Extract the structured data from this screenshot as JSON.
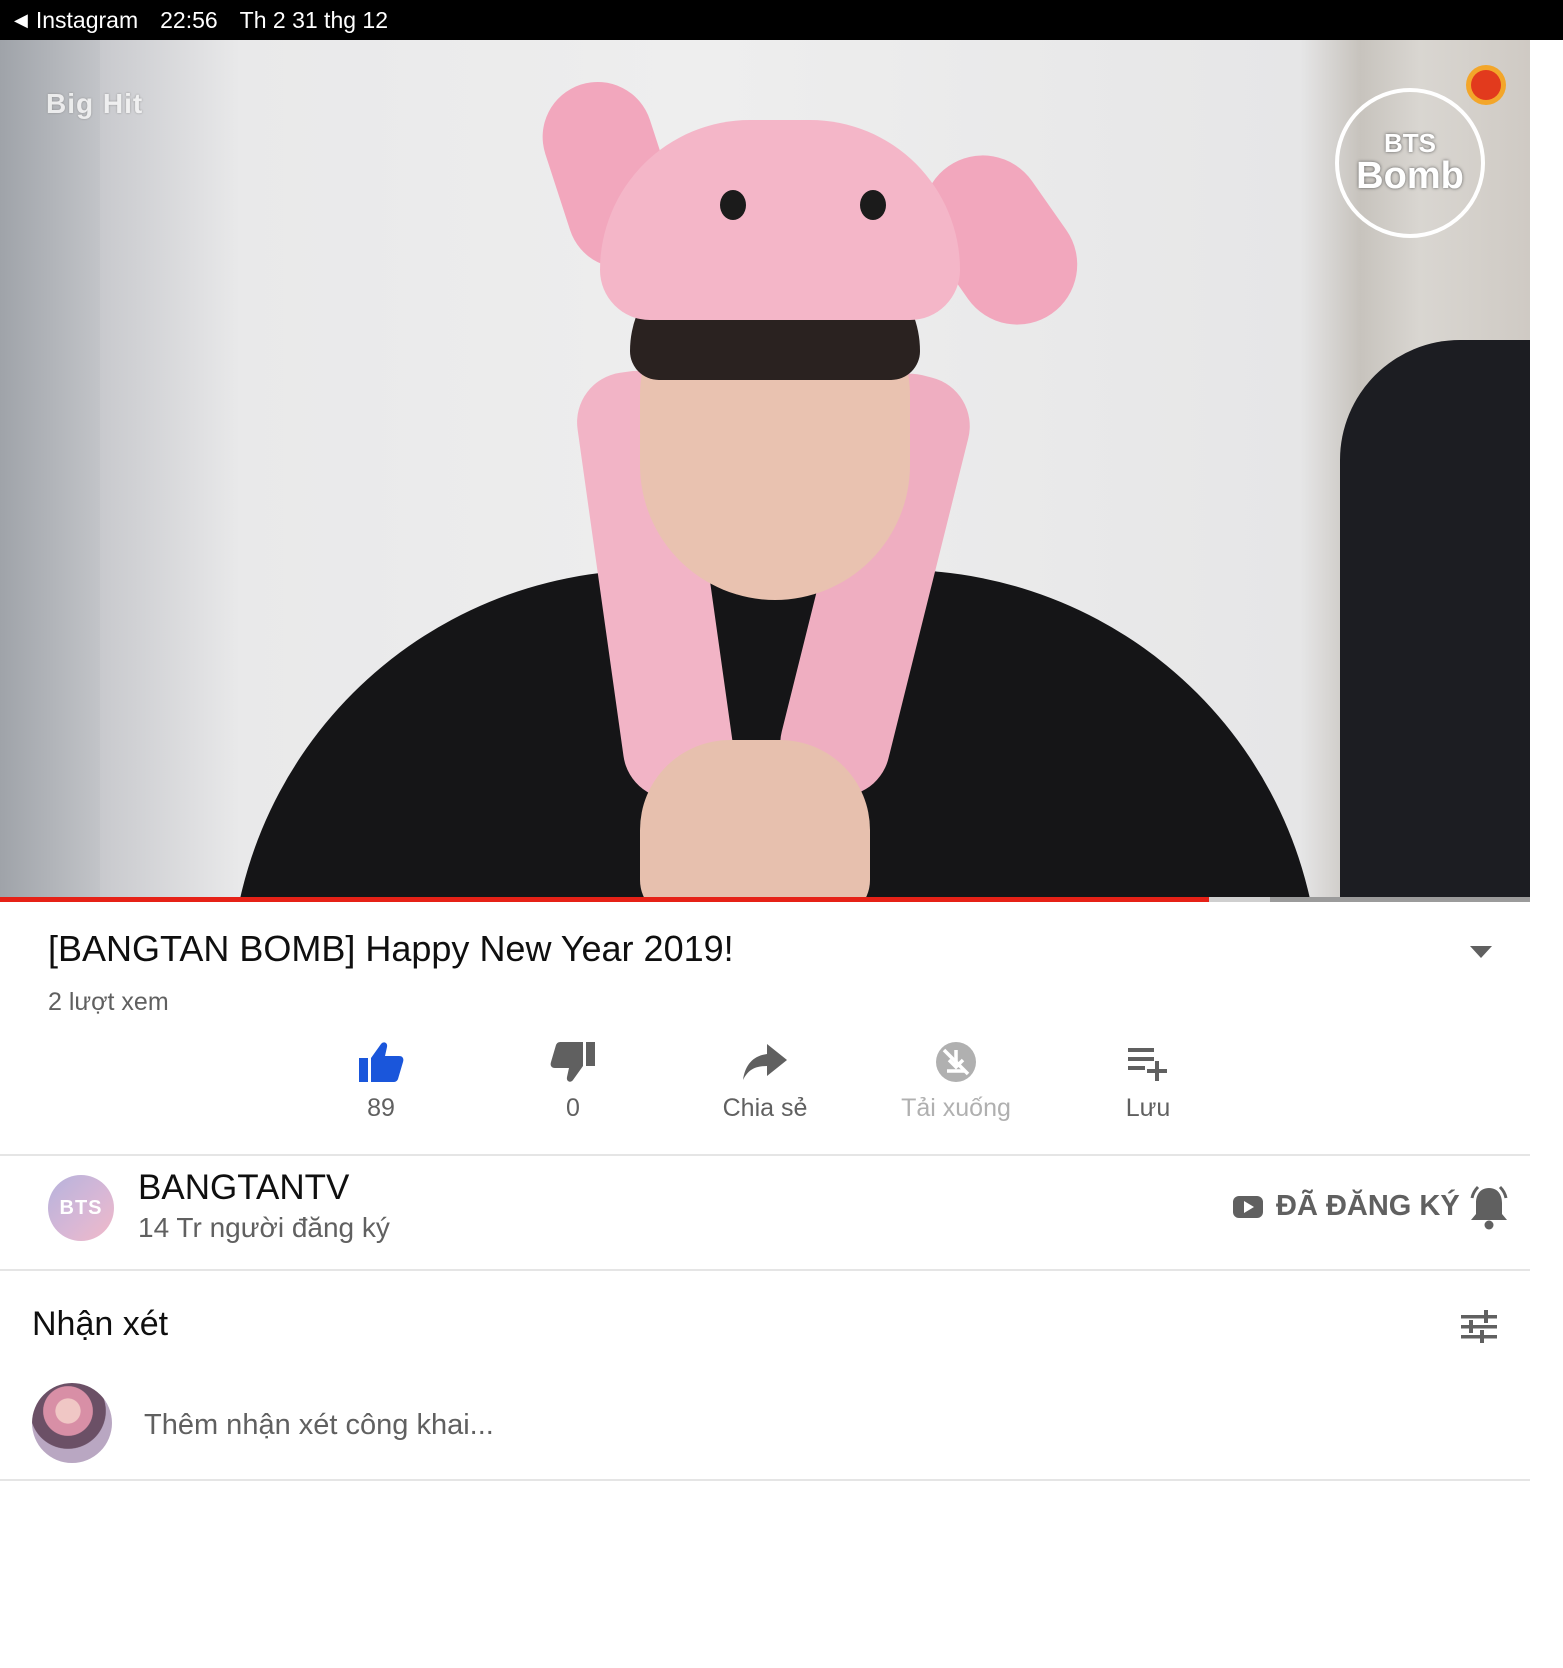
{
  "status_bar": {
    "back_app": "Instagram",
    "time": "22:56",
    "date": "Th 2 31 thg 12"
  },
  "video": {
    "watermark_left": "Big Hit",
    "watermark_right_line1": "BTS",
    "watermark_right_line2": "Bomb",
    "progress_played_fraction": 0.79,
    "progress_buffered_fraction": 0.83
  },
  "info": {
    "title": "[BANGTAN BOMB] Happy New Year 2019!",
    "views": "2 lượt xem"
  },
  "actions": [
    {
      "icon": "thumb-up-icon",
      "label": "89",
      "color": "#1a56db"
    },
    {
      "icon": "thumb-down-icon",
      "label": "0",
      "color": "#606060"
    },
    {
      "icon": "share-icon",
      "label": "Chia sẻ",
      "color": "#606060"
    },
    {
      "icon": "download-off-icon",
      "label": "Tải xuống",
      "color": "#b0b0b0"
    },
    {
      "icon": "playlist-add-icon",
      "label": "Lưu",
      "color": "#606060"
    }
  ],
  "channel": {
    "avatar_text": "BTS",
    "name": "BANGTANTV",
    "subscribers": "14 Tr người đăng ký",
    "subscribed_label": "ĐÃ ĐĂNG KÝ"
  },
  "comments": {
    "title": "Nhận xét",
    "placeholder": "Thêm nhận xét công khai..."
  },
  "colors": {
    "accent_red": "#e62117",
    "like_blue": "#1a56db",
    "text_secondary": "#606060"
  }
}
